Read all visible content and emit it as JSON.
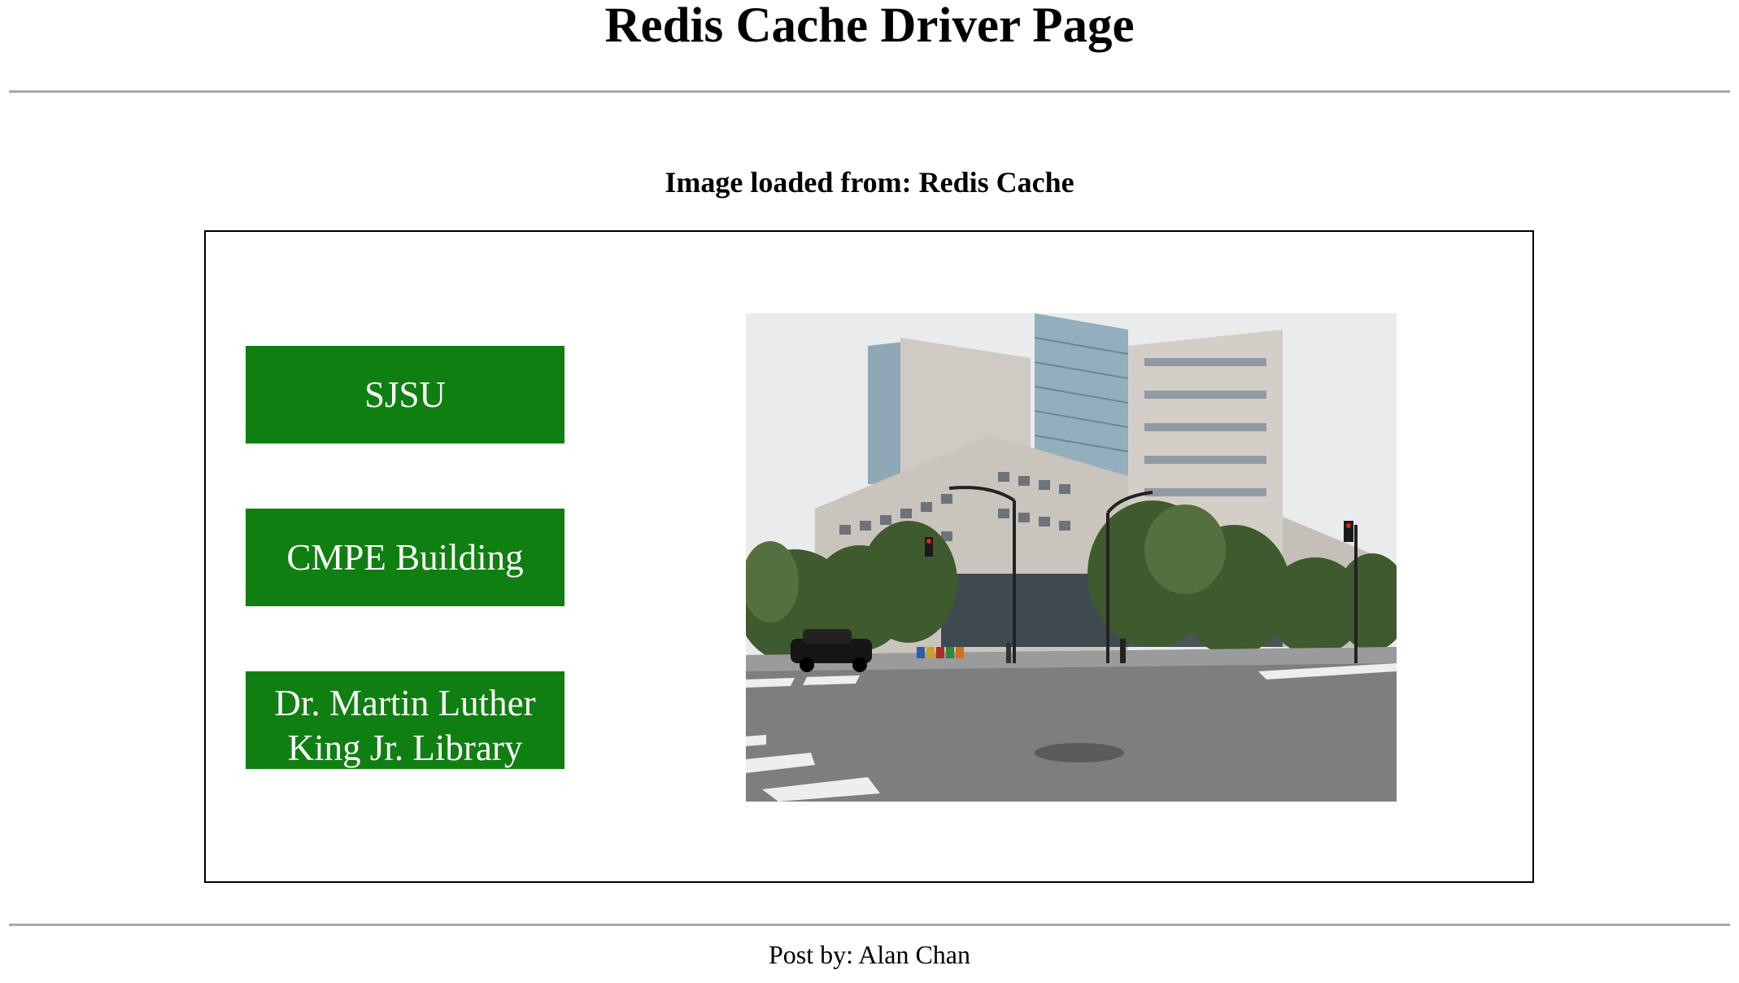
{
  "header": {
    "title": "Redis Cache Driver Page"
  },
  "main": {
    "source_label": "Image loaded from: Redis Cache",
    "buttons": [
      {
        "label": "SJSU"
      },
      {
        "label": "CMPE Building"
      },
      {
        "label": "Dr. Martin Luther King Jr. Library"
      }
    ],
    "image": {
      "description_alt": "Dr. Martin Luther King Jr. Library"
    }
  },
  "footer": {
    "text": "Post by: Alan Chan"
  },
  "colors": {
    "button_bg": "#107f12",
    "button_text": "#ffffff",
    "rule": "#a8a8a8"
  }
}
